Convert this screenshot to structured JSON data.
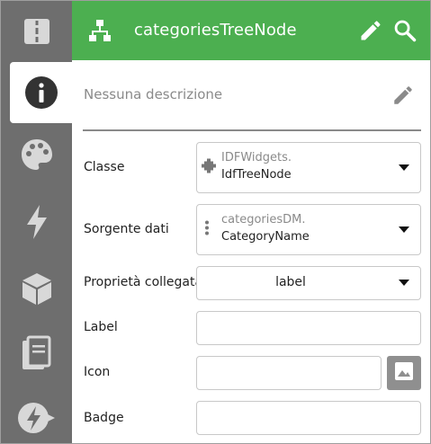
{
  "header": {
    "title": "categoriesTreeNode",
    "icons": [
      "tree-structure-icon",
      "pencil-icon",
      "search-icon"
    ]
  },
  "rail": {
    "items": [
      {
        "icon": "page-layout-icon",
        "active": false
      },
      {
        "icon": "info-icon",
        "active": true
      },
      {
        "icon": "palette-icon",
        "active": false
      },
      {
        "icon": "lightning-icon",
        "active": false
      },
      {
        "icon": "cube-icon",
        "active": false
      },
      {
        "icon": "book-icon",
        "active": false
      },
      {
        "icon": "flash-forward-icon",
        "active": false
      }
    ]
  },
  "description": {
    "text": "Nessuna descrizione",
    "icon": "pencil-icon"
  },
  "fields": {
    "classe": {
      "label": "Classe",
      "line1": "IDFWidgets.",
      "line2": "IdfTreeNode",
      "icon": "plugin-icon"
    },
    "sorgente": {
      "label": "Sorgente dati",
      "line1": "categoriesDM.",
      "line2": "CategoryName",
      "icon": "vertical-dots-icon"
    },
    "proprieta": {
      "label": "Proprietà collegata",
      "value": "label"
    },
    "label": {
      "label": "Label",
      "value": ""
    },
    "icon": {
      "label": "Icon",
      "value": "",
      "button_icon": "image-icon"
    },
    "badge": {
      "label": "Badge",
      "value": ""
    }
  },
  "colors": {
    "header": "#4caf50",
    "rail": "#6e6e6e",
    "rail_icon": "#d8d8d8",
    "active_icon": "#333333"
  }
}
